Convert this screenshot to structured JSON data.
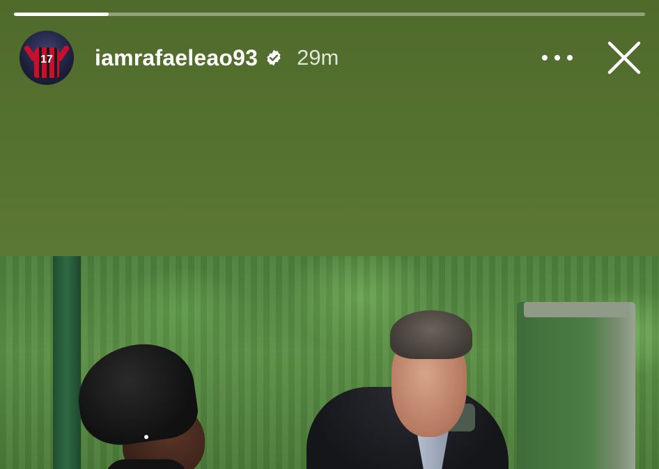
{
  "story": {
    "progress_fraction": 0.15,
    "author": {
      "username": "iamrafaeleao93",
      "verified": true,
      "avatar_icon": "avatar-player-17-icon",
      "avatar_text": "17"
    },
    "posted_ago": "29m",
    "more_icon": "more-options-icon",
    "close_icon": "close-icon",
    "background_color": "#56702f"
  }
}
